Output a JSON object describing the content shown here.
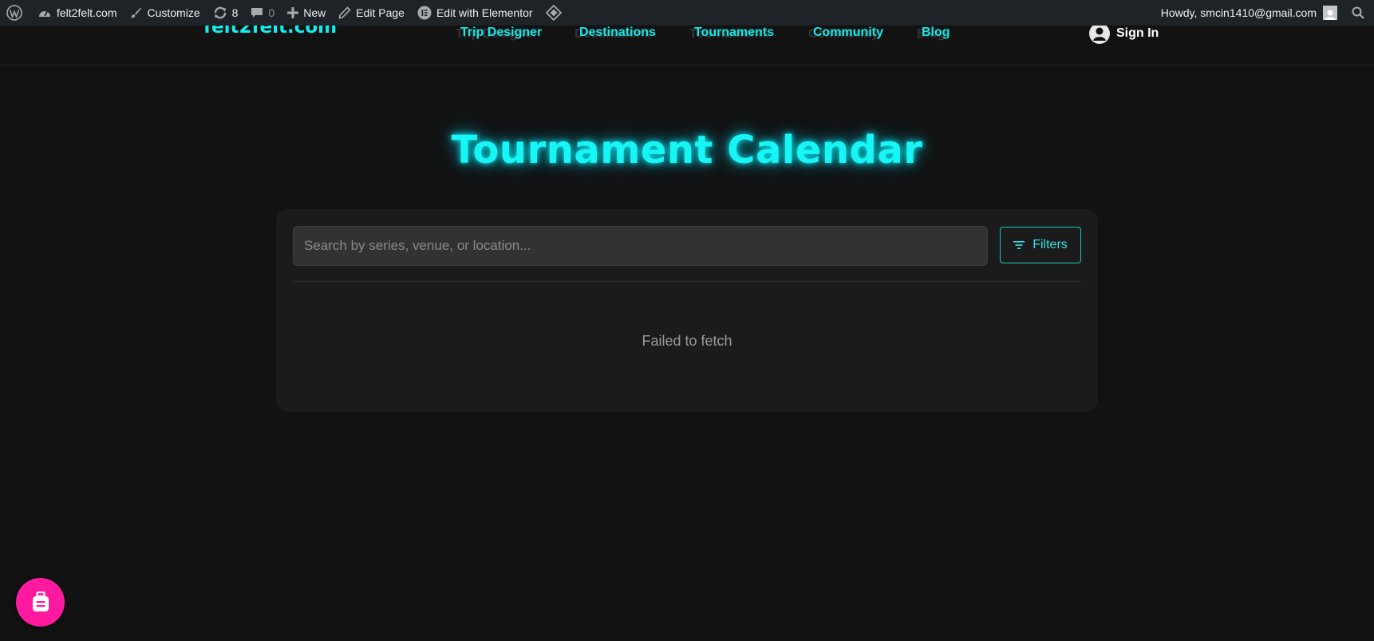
{
  "admin_bar": {
    "site_name": "felt2felt.com",
    "customize": "Customize",
    "updates_count": "8",
    "comments_count": "0",
    "new": "New",
    "edit_page": "Edit Page",
    "edit_elementor": "Edit with Elementor",
    "howdy": "Howdy, smcin1410@gmail.com"
  },
  "header": {
    "logo": "felt2felt.com",
    "nav": [
      "Trip Designer",
      "Destinations",
      "Tournaments",
      "Community",
      "Blog"
    ],
    "sign_in": "Sign In"
  },
  "main": {
    "title": "Tournament Calendar",
    "search_placeholder": "Search by series, venue, or location...",
    "filters_label": "Filters",
    "status_message": "Failed to fetch"
  },
  "colors": {
    "accent": "#10f0f0",
    "background": "#121212",
    "card": "#1b1b1b",
    "fab": "#ff1aa0"
  },
  "icons": {
    "admin_bar": [
      "wordpress-icon",
      "dashboard-icon",
      "brush-icon",
      "updates-icon",
      "comment-icon",
      "plus-icon",
      "pencil-icon",
      "elementor-icon",
      "diamond-icon",
      "search-icon"
    ],
    "filters": "filter-icon",
    "sign_in": "user-icon",
    "fab": "luggage-icon"
  }
}
